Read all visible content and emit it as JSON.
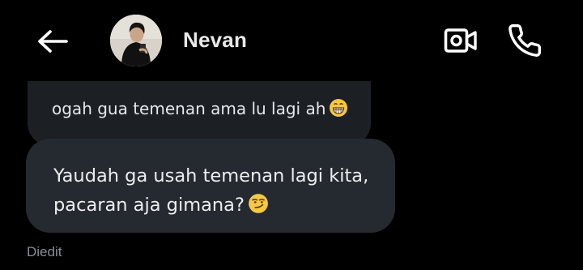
{
  "header": {
    "back_icon": "arrow-left-icon",
    "contact_name": "Nevan",
    "video_icon": "video-camera-icon",
    "call_icon": "phone-icon"
  },
  "messages": [
    {
      "text": "ogah gua temenan ama lu lagi ah",
      "emoji": "grinning-face-icon"
    },
    {
      "line1": "Yaudah ga usah temenan lagi kita,",
      "line2": "pacaran aja gimana?",
      "emoji": "smirking-face-icon"
    }
  ],
  "status": {
    "edited_label": "Diedit"
  },
  "colors": {
    "background": "#000000",
    "bubble_previous": "#1c1f23",
    "bubble_current": "#252a31",
    "muted_text": "#8a8f96",
    "emoji_yellow": "#f7c843"
  }
}
